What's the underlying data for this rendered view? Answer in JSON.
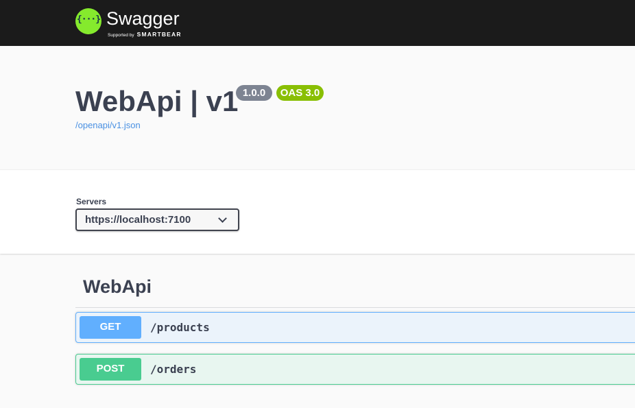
{
  "topbar": {
    "logo_glyph": "{···}",
    "brand": "Swagger",
    "brand_tm": ".",
    "supported_by": "Supported by",
    "company": "SMARTBEAR"
  },
  "info": {
    "title": "WebApi | v1",
    "version": "1.0.0",
    "oas": "OAS 3.0",
    "spec_url": "/openapi/v1.json"
  },
  "servers": {
    "label": "Servers",
    "selected": "https://localhost:7100"
  },
  "tag": {
    "name": "WebApi",
    "operations": [
      {
        "method": "GET",
        "path": "/products"
      },
      {
        "method": "POST",
        "path": "/orders"
      }
    ]
  },
  "colors": {
    "topbar": "#1b1b1b",
    "logo": "#85ea2d",
    "get": "#61affe",
    "post": "#49cc90",
    "version_badge": "#7d8492",
    "oas_badge": "#89bf04",
    "link": "#4990e2"
  }
}
